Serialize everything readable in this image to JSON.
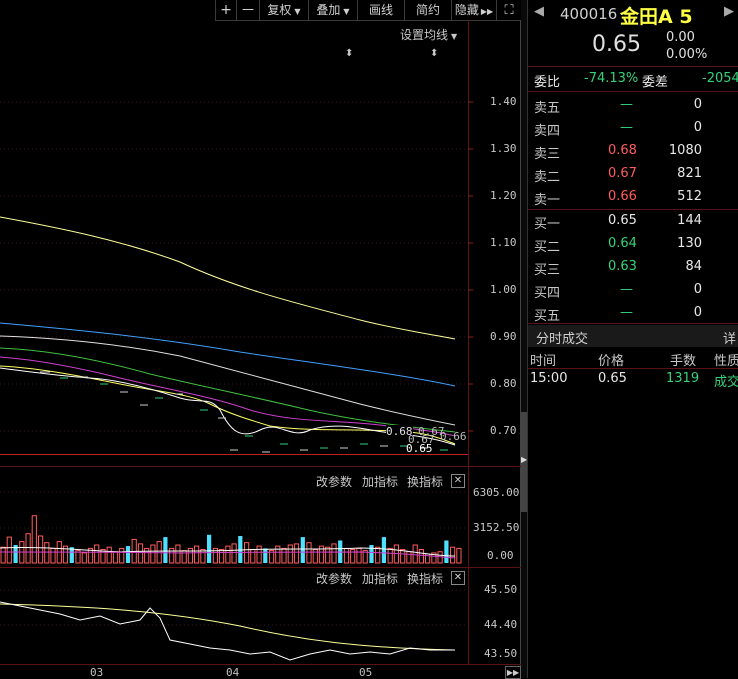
{
  "toolbar": {
    "plus": "+",
    "minus": "一",
    "restore_rights": "复权",
    "overlay": "叠加",
    "draw_line": "画线",
    "short_contract": "简约",
    "hide": "隐藏"
  },
  "main_chart": {
    "set_ma_label": "设置均线",
    "y_ticks": [
      "1.40",
      "1.30",
      "1.20",
      "1.10",
      "1.00",
      "0.90",
      "0.80",
      "0.70"
    ],
    "price_labels": [
      "0.68",
      "0.67",
      "0.67",
      "0.66",
      "0.65"
    ]
  },
  "volume_panel": {
    "tools": [
      "改参数",
      "加指标",
      "换指标"
    ],
    "y_ticks": [
      "6305.00",
      "3152.50",
      "0.00"
    ],
    "chart_data": {
      "type": "bar",
      "ylim": [
        0,
        6305
      ],
      "values": [
        1400,
        2300,
        1600,
        1900,
        2600,
        4200,
        2400,
        1800,
        1300,
        1900,
        1500,
        1400,
        1100,
        900,
        1300,
        1600,
        1200,
        1400,
        1000,
        1300,
        1500,
        2100,
        1700,
        1300,
        1600,
        1900,
        2300,
        1300,
        1600,
        1100,
        1300,
        1500,
        1200,
        2500,
        1300,
        1200,
        1500,
        1700,
        2400,
        1800,
        1200,
        1500,
        1300,
        1100,
        1500,
        1300,
        1600,
        1700,
        2300,
        1800,
        1200,
        1500,
        1400,
        1700,
        2000,
        1300,
        1200,
        1300,
        1100,
        1600,
        1400,
        2300,
        1300,
        1600,
        1200,
        1000,
        1600,
        1200,
        800,
        900,
        1000,
        2000,
        1400,
        1300
      ],
      "colors": [
        "red",
        "red",
        "cyan",
        "red",
        "red",
        "red",
        "red",
        "red",
        "red",
        "red",
        "red",
        "cyan",
        "red",
        "red",
        "red",
        "red",
        "red",
        "red",
        "red",
        "red",
        "cyan",
        "red",
        "red",
        "red",
        "red",
        "red",
        "cyan",
        "red",
        "red",
        "red",
        "red",
        "red",
        "red",
        "cyan",
        "red",
        "red",
        "red",
        "red",
        "cyan",
        "red",
        "red",
        "red",
        "cyan",
        "red",
        "red",
        "red",
        "red",
        "red",
        "cyan",
        "red",
        "red",
        "red",
        "red",
        "red",
        "cyan",
        "red",
        "red",
        "red",
        "red",
        "cyan",
        "red",
        "cyan",
        "red",
        "red",
        "red",
        "red",
        "red",
        "red",
        "red",
        "red",
        "red",
        "cyan",
        "red",
        "red"
      ]
    }
  },
  "indicator_panel": {
    "tools": [
      "改参数",
      "加指标",
      "换指标"
    ],
    "y_ticks": [
      "45.50",
      "44.40",
      "43.50"
    ]
  },
  "x_axis": [
    "03",
    "04",
    "05"
  ],
  "quote": {
    "code": "400016",
    "name": "金田A 5",
    "price": "0.65",
    "change": "0.00",
    "change_pct": "0.00%",
    "weibi_label": "委比",
    "weibi_value": "-74.13%",
    "weicha_label": "委差",
    "weicha_value": "-2054",
    "asks": [
      {
        "label": "卖五",
        "price": "—",
        "vol": "0"
      },
      {
        "label": "卖四",
        "price": "—",
        "vol": "0"
      },
      {
        "label": "卖三",
        "price": "0.68",
        "vol": "1080"
      },
      {
        "label": "卖二",
        "price": "0.67",
        "vol": "821"
      },
      {
        "label": "卖一",
        "price": "0.66",
        "vol": "512"
      }
    ],
    "bids": [
      {
        "label": "买一",
        "price": "0.65",
        "vol": "144"
      },
      {
        "label": "买二",
        "price": "0.64",
        "vol": "130"
      },
      {
        "label": "买三",
        "price": "0.63",
        "vol": "84"
      },
      {
        "label": "买四",
        "price": "—",
        "vol": "0"
      },
      {
        "label": "买五",
        "price": "—",
        "vol": "0"
      }
    ],
    "ticks_title": "分时成交",
    "ticks_detail": "详",
    "ticks_headers": [
      "时间",
      "价格",
      "手数",
      "性质"
    ],
    "ticks": [
      {
        "time": "15:00",
        "price": "0.65",
        "vol": "1319",
        "nature": "成交"
      }
    ]
  },
  "colors": {
    "up": "#ff5c5c",
    "down": "#35d27a",
    "cyan_bar": "#4fe0ff",
    "ma5": "#ffffff",
    "ma10": "#ffff66",
    "ma20": "#d040d0",
    "ma30": "#40c040",
    "ma60": "#e0e0e0",
    "ma120": "#40a0ff",
    "ma250": "#ffff99"
  }
}
